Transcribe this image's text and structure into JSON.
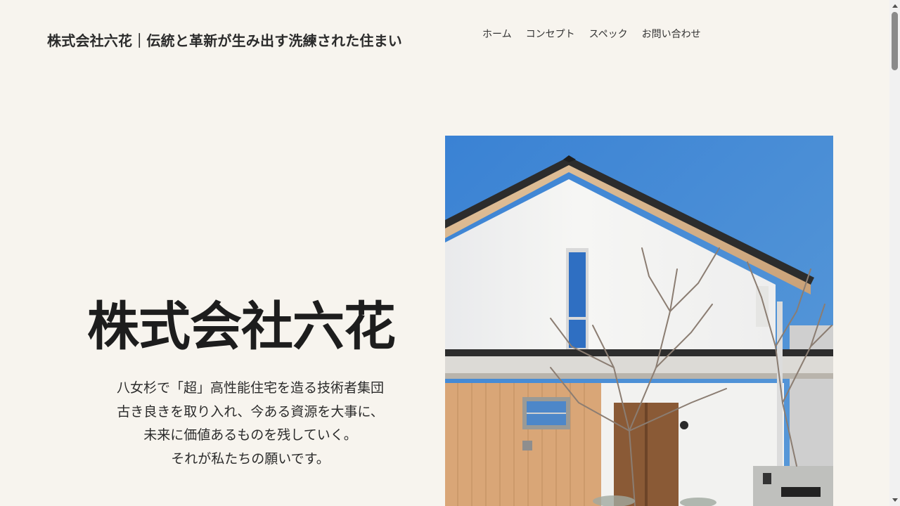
{
  "header": {
    "site_title": "株式会社六花｜伝統と革新が生み出す洗練された住まい",
    "nav": [
      {
        "label": "ホーム"
      },
      {
        "label": "コンセプト"
      },
      {
        "label": "スペック"
      },
      {
        "label": "お問い合わせ"
      }
    ]
  },
  "hero": {
    "title": "株式会社六花",
    "lines": [
      "八女杉で「超」高性能住宅を造る技術者集団",
      "古き良きを取り入れ、今ある資源を大事に、",
      "未来に価値あるものを残していく。",
      "それが私たちの願いです。"
    ]
  },
  "colors": {
    "background": "#f7f4ee",
    "sky": "#3f86d3",
    "wall": "#f4f4f2",
    "wood": "#d8a577",
    "roof": "#2f2f2f"
  }
}
